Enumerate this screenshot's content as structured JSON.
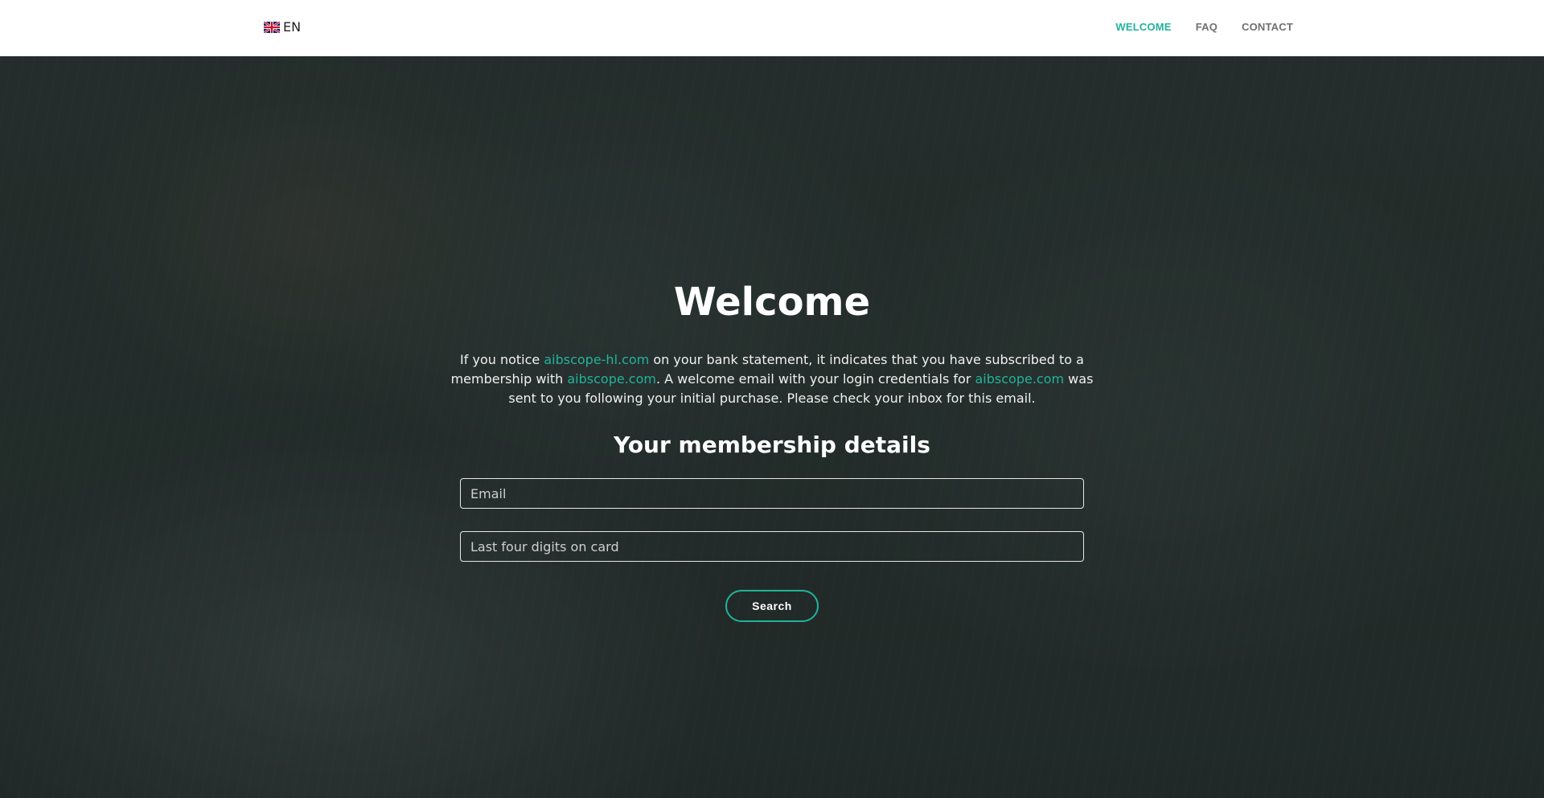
{
  "header": {
    "language": {
      "icon": "uk-flag-icon",
      "label": "EN"
    },
    "nav": [
      {
        "label": "WELCOME",
        "active": true
      },
      {
        "label": "FAQ",
        "active": false
      },
      {
        "label": "CONTACT",
        "active": false
      }
    ]
  },
  "hero": {
    "title": "Welcome",
    "intro": {
      "part1": "If you notice ",
      "link1": "aibscope-hl.com",
      "part2": " on your bank statement, it indicates that you have subscribed to a membership with ",
      "link2": "aibscope.com",
      "part3": ". A welcome email with your login credentials for ",
      "link3": "aibscope.com",
      "part4": " was sent to you following your initial purchase. Please check your inbox for this email."
    },
    "subtitle": "Your membership details",
    "form": {
      "email_placeholder": "Email",
      "email_value": "",
      "digits_placeholder": "Last four digits on card",
      "digits_value": "",
      "search_label": "Search"
    }
  },
  "colors": {
    "accent": "#21b39b",
    "header_bg": "#ffffff",
    "nav_inactive": "#707070",
    "hero_overlay": "#2a3432"
  }
}
